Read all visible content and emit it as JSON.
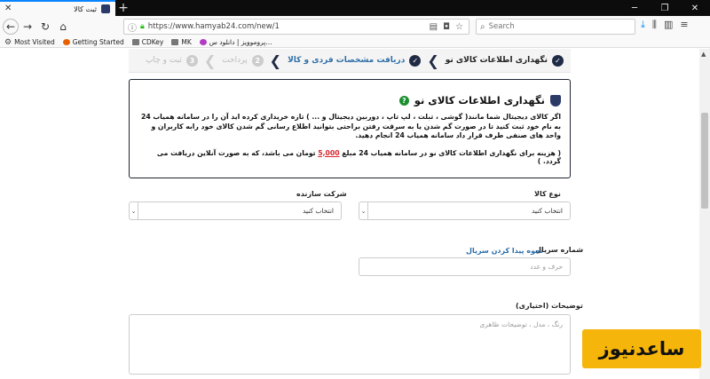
{
  "browser": {
    "tab_title": "ثبت کالا",
    "url": "https://www.hamyab24.com/new/1",
    "search_placeholder": "Search",
    "bookmarks": [
      "Most Visited",
      "Getting Started",
      "CDKey",
      "MK",
      "پروموویز | دانلود س..."
    ]
  },
  "steps": [
    {
      "label": "نگهداری اطلاعات کالای نو",
      "state": "done"
    },
    {
      "label": "دریافت مشخصات فردی و کالا",
      "state": "active"
    },
    {
      "label": "پرداخت",
      "num": "2",
      "state": "pending"
    },
    {
      "label": "ثبت و چاپ",
      "num": "3",
      "state": "pending"
    }
  ],
  "info": {
    "title": "نگهداری اطلاعات کالای نو",
    "help": "?",
    "body": "اگر کالای دیجیتال شما مانند( گوشی ، تبلت ، لپ تاپ ، دوربین دیجیتال و ... ) تازه خریداری کرده اید آن را در سامانه همیاب 24 به نام خود ثبت کنید تا در صورت گم شدن یا به سرقت رفتن براحتی بتوانید اطلاع رسانی گم شدن کالای خود رابه کاربران و واحد های صنفی طرف قرار داد سامانه همیاب 24 انجام دهید.",
    "fee_prefix": "( هزینه برای نگهداری اطلاعات کالای نو در سامانه همیاب 24 مبلغ",
    "fee_amount": "5,000",
    "fee_suffix": "تومان می باشد، که به صورت آنلاین دریافت می گردد. )"
  },
  "form": {
    "product_type_label": "نوع کالا",
    "product_type_value": "انتخاب کنید",
    "manufacturer_label": "شرکت سازنده",
    "manufacturer_value": "انتخاب کنید",
    "serial_label": "شماره سریال",
    "serial_help_link": "نحوه پیدا کردن سریال",
    "serial_placeholder": "حرف و عدد",
    "desc_label": "توضیحات (اختیاری)",
    "desc_placeholder": "رنگ ، مدل ، توضیحات ظاهری"
  },
  "watermark": "ساعدنیوز"
}
